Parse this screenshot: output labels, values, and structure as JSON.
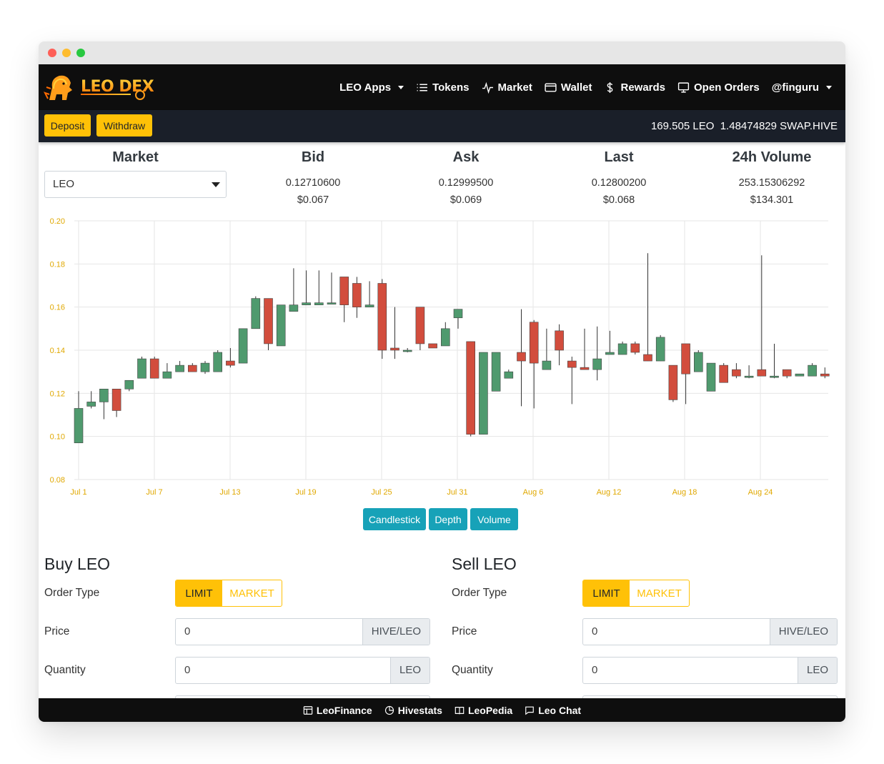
{
  "app": {
    "brand": "LEO DEX"
  },
  "nav": {
    "items": [
      {
        "label": "LEO Apps",
        "icon": "",
        "dropdown": true
      },
      {
        "label": "Tokens",
        "icon": "list-icon"
      },
      {
        "label": "Market",
        "icon": "pulse-icon"
      },
      {
        "label": "Wallet",
        "icon": "wallet-icon"
      },
      {
        "label": "Rewards",
        "icon": "dollar-icon"
      },
      {
        "label": "Open Orders",
        "icon": "monitor-icon"
      },
      {
        "label": "@finguru",
        "icon": "",
        "dropdown": true
      }
    ]
  },
  "subbar": {
    "deposit_label": "Deposit",
    "withdraw_label": "Withdraw",
    "leo_balance": "169.505 LEO",
    "swap_balance": "1.48474829 SWAP.HIVE"
  },
  "stats": {
    "market_header": "Market",
    "market_selected": "LEO",
    "bid": {
      "header": "Bid",
      "value": "0.12710600",
      "usd": "$0.067"
    },
    "ask": {
      "header": "Ask",
      "value": "0.12999500",
      "usd": "$0.069"
    },
    "last": {
      "header": "Last",
      "value": "0.12800200",
      "usd": "$0.068"
    },
    "volume": {
      "header": "24h Volume",
      "value": "253.15306292",
      "usd": "$134.301"
    }
  },
  "chart_data": {
    "type": "candlestick",
    "ylim": [
      0.08,
      0.2
    ],
    "yticks": [
      "0.20",
      "0.18",
      "0.16",
      "0.14",
      "0.12",
      "0.10",
      "0.08"
    ],
    "xticks": [
      "Jul 1",
      "Jul 7",
      "Jul 13",
      "Jul 19",
      "Jul 25",
      "Jul 31",
      "Aug 6",
      "Aug 12",
      "Aug 18",
      "Aug 24"
    ],
    "up_color": "#4f9a6e",
    "down_color": "#d24d3d",
    "candles": [
      {
        "o": 0.097,
        "h": 0.121,
        "l": 0.097,
        "c": 0.113
      },
      {
        "o": 0.114,
        "h": 0.121,
        "l": 0.113,
        "c": 0.116
      },
      {
        "o": 0.116,
        "h": 0.121,
        "l": 0.108,
        "c": 0.122
      },
      {
        "o": 0.122,
        "h": 0.122,
        "l": 0.109,
        "c": 0.112
      },
      {
        "o": 0.122,
        "h": 0.125,
        "l": 0.121,
        "c": 0.126
      },
      {
        "o": 0.127,
        "h": 0.137,
        "l": 0.127,
        "c": 0.136
      },
      {
        "o": 0.136,
        "h": 0.137,
        "l": 0.127,
        "c": 0.127
      },
      {
        "o": 0.127,
        "h": 0.134,
        "l": 0.127,
        "c": 0.13
      },
      {
        "o": 0.13,
        "h": 0.135,
        "l": 0.13,
        "c": 0.133
      },
      {
        "o": 0.133,
        "h": 0.134,
        "l": 0.13,
        "c": 0.13
      },
      {
        "o": 0.13,
        "h": 0.135,
        "l": 0.129,
        "c": 0.134
      },
      {
        "o": 0.13,
        "h": 0.14,
        "l": 0.13,
        "c": 0.139
      },
      {
        "o": 0.135,
        "h": 0.141,
        "l": 0.132,
        "c": 0.133
      },
      {
        "o": 0.134,
        "h": 0.15,
        "l": 0.134,
        "c": 0.15
      },
      {
        "o": 0.15,
        "h": 0.165,
        "l": 0.15,
        "c": 0.164
      },
      {
        "o": 0.164,
        "h": 0.164,
        "l": 0.14,
        "c": 0.143
      },
      {
        "o": 0.142,
        "h": 0.161,
        "l": 0.142,
        "c": 0.161
      },
      {
        "o": 0.158,
        "h": 0.178,
        "l": 0.158,
        "c": 0.161
      },
      {
        "o": 0.161,
        "h": 0.177,
        "l": 0.161,
        "c": 0.162
      },
      {
        "o": 0.161,
        "h": 0.177,
        "l": 0.161,
        "c": 0.162
      },
      {
        "o": 0.162,
        "h": 0.176,
        "l": 0.162,
        "c": 0.162
      },
      {
        "o": 0.174,
        "h": 0.174,
        "l": 0.153,
        "c": 0.161
      },
      {
        "o": 0.171,
        "h": 0.174,
        "l": 0.155,
        "c": 0.16
      },
      {
        "o": 0.16,
        "h": 0.172,
        "l": 0.16,
        "c": 0.161
      },
      {
        "o": 0.171,
        "h": 0.173,
        "l": 0.136,
        "c": 0.14
      },
      {
        "o": 0.141,
        "h": 0.16,
        "l": 0.136,
        "c": 0.14
      },
      {
        "o": 0.14,
        "h": 0.141,
        "l": 0.139,
        "c": 0.14
      },
      {
        "o": 0.16,
        "h": 0.16,
        "l": 0.14,
        "c": 0.143
      },
      {
        "o": 0.143,
        "h": 0.143,
        "l": 0.141,
        "c": 0.141
      },
      {
        "o": 0.142,
        "h": 0.153,
        "l": 0.142,
        "c": 0.15
      },
      {
        "o": 0.155,
        "h": 0.159,
        "l": 0.15,
        "c": 0.159
      },
      {
        "o": 0.144,
        "h": 0.144,
        "l": 0.1,
        "c": 0.101
      },
      {
        "o": 0.101,
        "h": 0.139,
        "l": 0.101,
        "c": 0.139
      },
      {
        "o": 0.121,
        "h": 0.139,
        "l": 0.121,
        "c": 0.139
      },
      {
        "o": 0.127,
        "h": 0.131,
        "l": 0.127,
        "c": 0.13
      },
      {
        "o": 0.139,
        "h": 0.159,
        "l": 0.114,
        "c": 0.135
      },
      {
        "o": 0.153,
        "h": 0.154,
        "l": 0.113,
        "c": 0.134
      },
      {
        "o": 0.131,
        "h": 0.15,
        "l": 0.131,
        "c": 0.135
      },
      {
        "o": 0.149,
        "h": 0.152,
        "l": 0.133,
        "c": 0.14
      },
      {
        "o": 0.135,
        "h": 0.137,
        "l": 0.115,
        "c": 0.132
      },
      {
        "o": 0.132,
        "h": 0.15,
        "l": 0.131,
        "c": 0.131
      },
      {
        "o": 0.131,
        "h": 0.151,
        "l": 0.126,
        "c": 0.136
      },
      {
        "o": 0.138,
        "h": 0.149,
        "l": 0.138,
        "c": 0.139
      },
      {
        "o": 0.138,
        "h": 0.144,
        "l": 0.138,
        "c": 0.143
      },
      {
        "o": 0.143,
        "h": 0.144,
        "l": 0.138,
        "c": 0.139
      },
      {
        "o": 0.138,
        "h": 0.185,
        "l": 0.135,
        "c": 0.135
      },
      {
        "o": 0.135,
        "h": 0.147,
        "l": 0.135,
        "c": 0.146
      },
      {
        "o": 0.133,
        "h": 0.133,
        "l": 0.116,
        "c": 0.117
      },
      {
        "o": 0.143,
        "h": 0.143,
        "l": 0.115,
        "c": 0.129
      },
      {
        "o": 0.13,
        "h": 0.14,
        "l": 0.13,
        "c": 0.139
      },
      {
        "o": 0.121,
        "h": 0.134,
        "l": 0.121,
        "c": 0.134
      },
      {
        "o": 0.133,
        "h": 0.134,
        "l": 0.125,
        "c": 0.125
      },
      {
        "o": 0.131,
        "h": 0.134,
        "l": 0.127,
        "c": 0.128
      },
      {
        "o": 0.128,
        "h": 0.133,
        "l": 0.127,
        "c": 0.128
      },
      {
        "o": 0.131,
        "h": 0.184,
        "l": 0.128,
        "c": 0.128
      },
      {
        "o": 0.128,
        "h": 0.143,
        "l": 0.127,
        "c": 0.128
      },
      {
        "o": 0.131,
        "h": 0.131,
        "l": 0.127,
        "c": 0.128
      },
      {
        "o": 0.128,
        "h": 0.129,
        "l": 0.128,
        "c": 0.129
      },
      {
        "o": 0.128,
        "h": 0.134,
        "l": 0.128,
        "c": 0.133
      },
      {
        "o": 0.129,
        "h": 0.132,
        "l": 0.127,
        "c": 0.128
      }
    ],
    "buttons": [
      "Candlestick",
      "Depth",
      "Volume"
    ]
  },
  "buy": {
    "title": "Buy LEO",
    "order_type_label": "Order Type",
    "limit_label": "LIMIT",
    "market_label": "MARKET",
    "price_label": "Price",
    "price_value": "0",
    "price_unit": "HIVE/LEO",
    "quantity_label": "Quantity",
    "quantity_value": "0",
    "quantity_unit": "LEO"
  },
  "sell": {
    "title": "Sell LEO",
    "order_type_label": "Order Type",
    "limit_label": "LIMIT",
    "market_label": "MARKET",
    "price_label": "Price",
    "price_value": "0",
    "price_unit": "HIVE/LEO",
    "quantity_label": "Quantity",
    "quantity_value": "0",
    "quantity_unit": "LEO"
  },
  "footer": {
    "items": [
      {
        "label": "LeoFinance",
        "icon": "newspaper-icon"
      },
      {
        "label": "Hivestats",
        "icon": "pie-chart-icon"
      },
      {
        "label": "LeoPedia",
        "icon": "book-icon"
      },
      {
        "label": "Leo Chat",
        "icon": "chat-icon"
      }
    ]
  }
}
